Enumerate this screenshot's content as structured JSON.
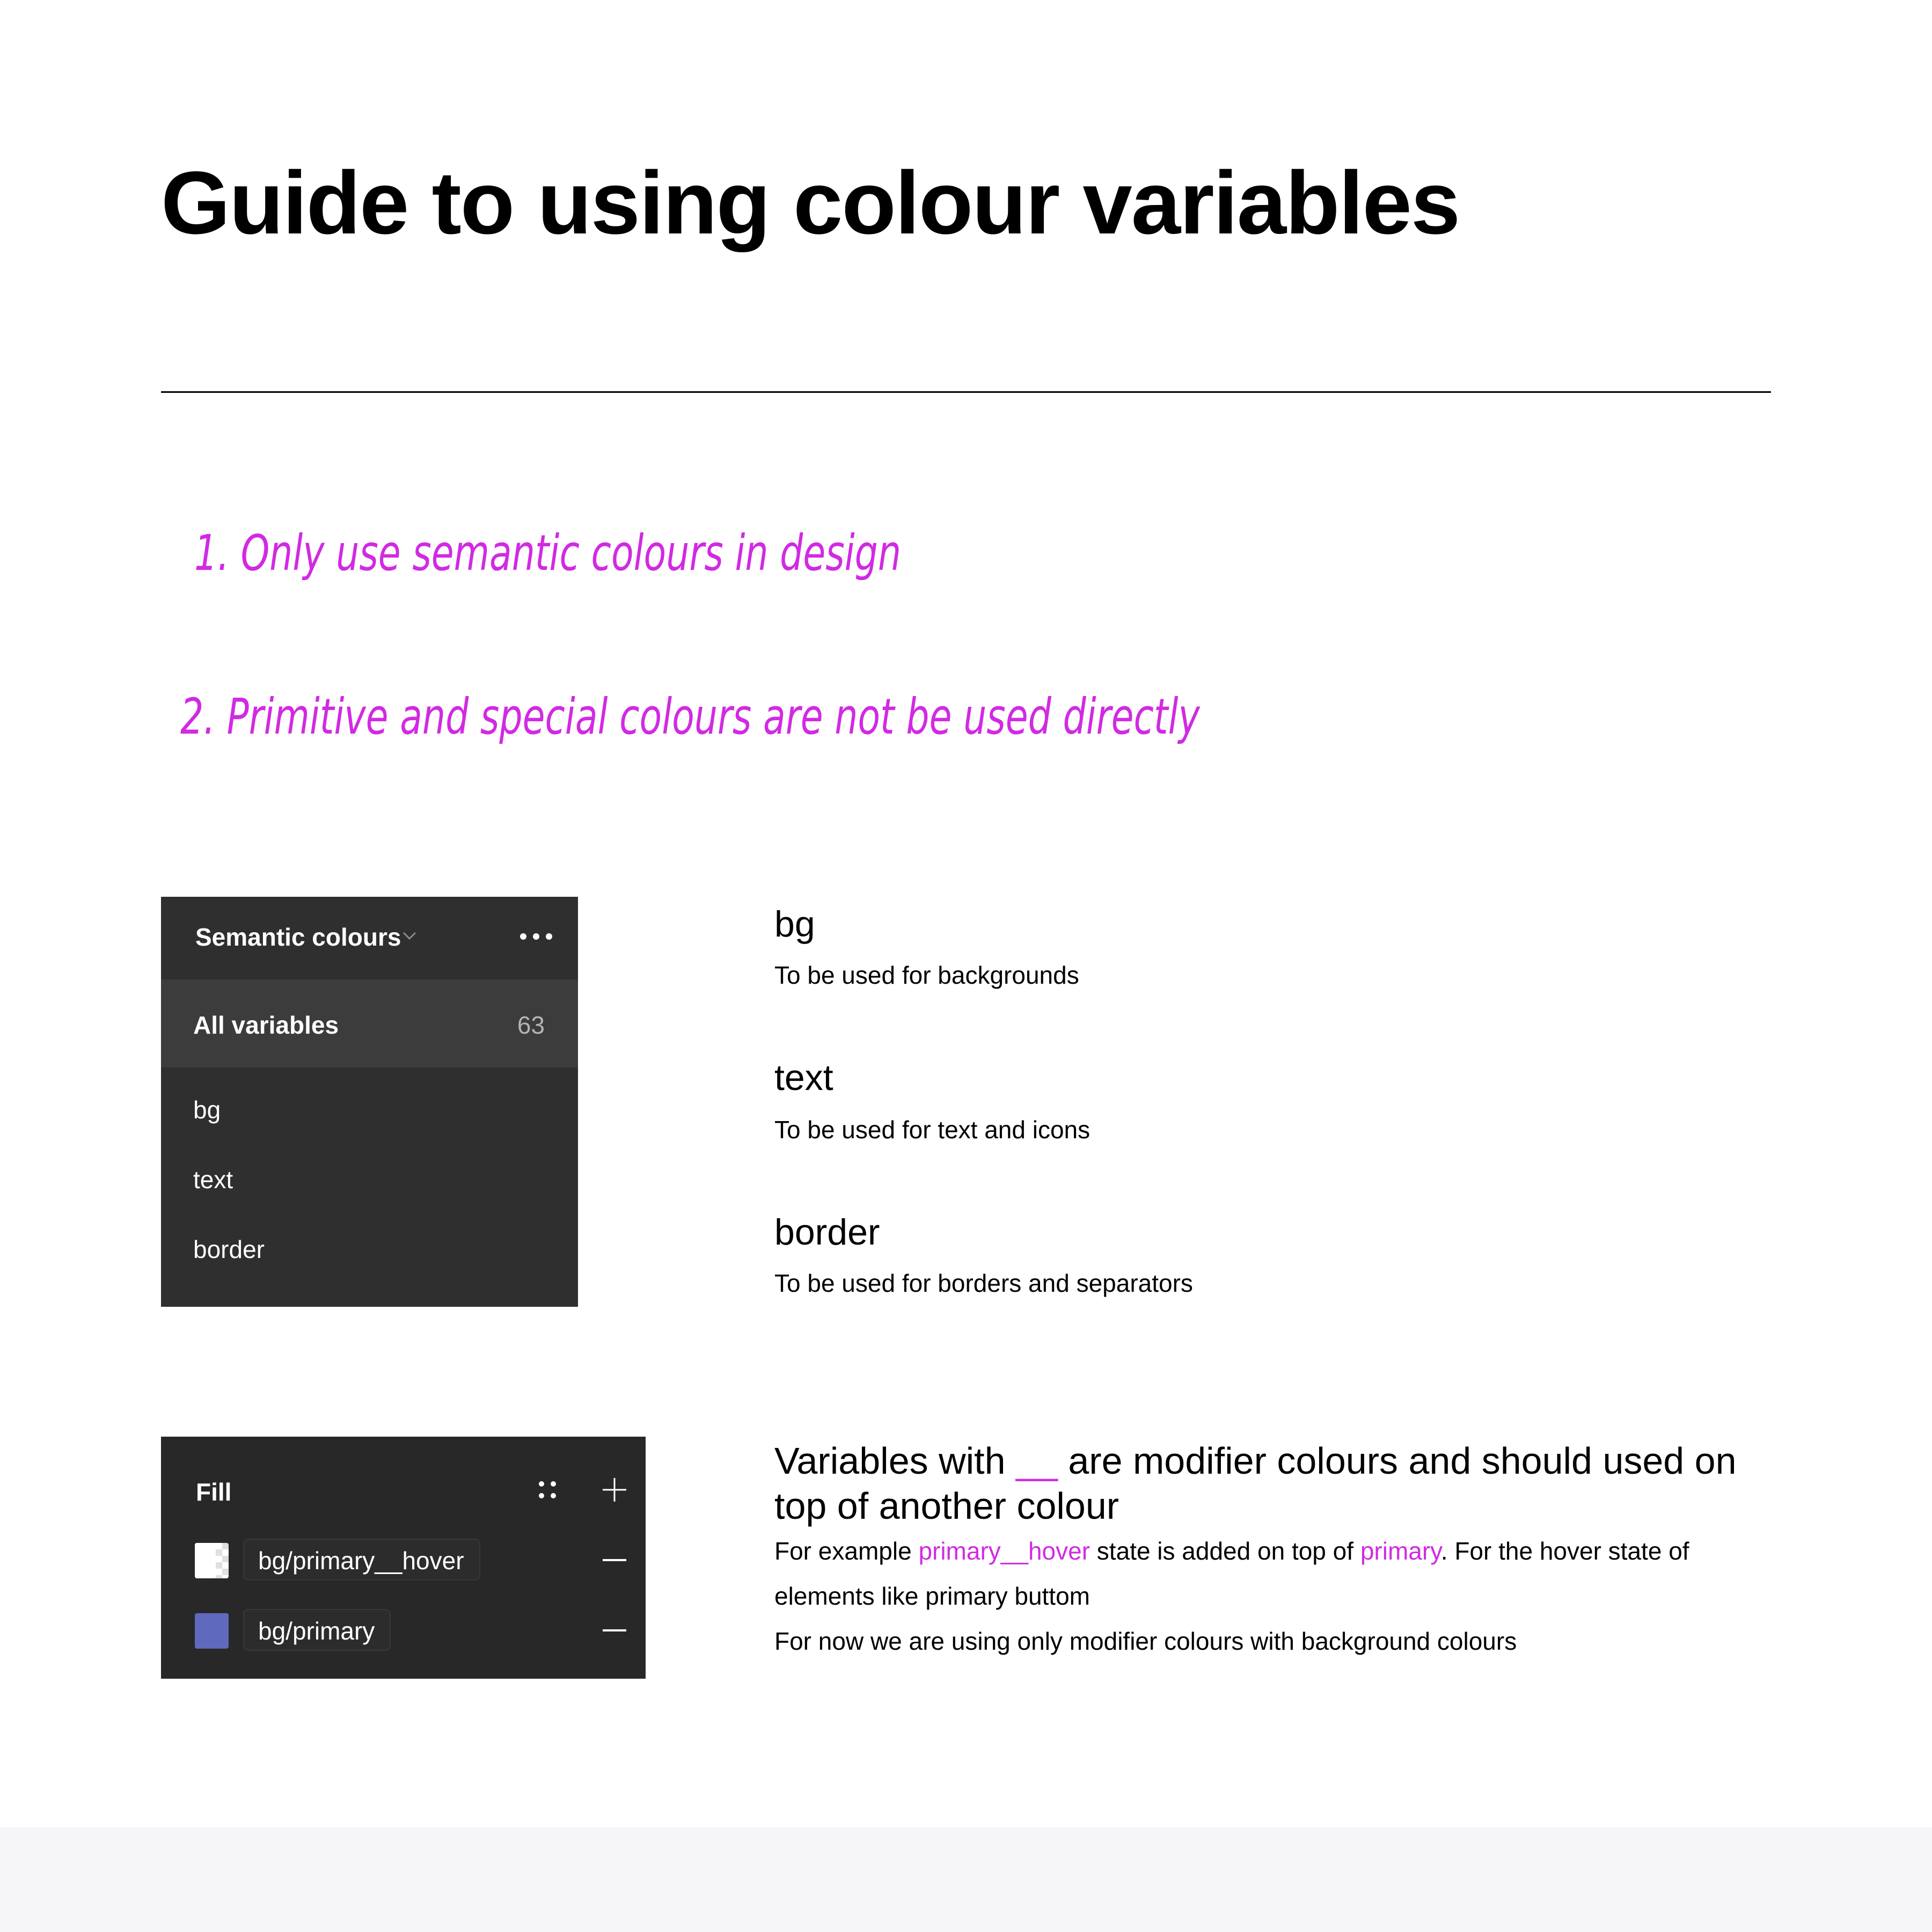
{
  "page": {
    "title": "Guide to using colour variables"
  },
  "rules": [
    "1. Only use semantic colours in design",
    "2. Primitive and special colours are not be used directly"
  ],
  "variables_panel": {
    "collection_name": "Semantic colours",
    "chevron_icon": "chevron-down",
    "more_icon": "ellipsis",
    "all_variables": {
      "label": "All variables",
      "count": "63"
    },
    "groups": [
      "bg",
      "text",
      "border"
    ]
  },
  "group_descriptions": [
    {
      "name": "bg",
      "description": "To be used for backgrounds"
    },
    {
      "name": "text",
      "description": "To be used for text and icons"
    },
    {
      "name": "border",
      "description": "To be used for borders and separators"
    }
  ],
  "fill_panel": {
    "title": "Fill",
    "styles_icon": "four-dots-grid",
    "add_icon": "plus",
    "remove_icon": "minus",
    "fills": [
      {
        "swatch": "transparent-checker",
        "variable": "bg/primary__hover"
      },
      {
        "swatch": "#5f6abf",
        "variable": "bg/primary"
      }
    ]
  },
  "modifier_note": {
    "heading_before": "Variables with ",
    "heading_token": "__",
    "heading_after": " are modifier colours and should used on top of another colour",
    "body_line1_a": "For example ",
    "body_line1_token1": "primary__hover",
    "body_line1_b": " state is added on top of ",
    "body_line1_token2": "primary",
    "body_line1_c": ". For the hover state of elements like primary buttom",
    "body_line2": "For now we are using only modifier colours with background colours"
  },
  "colors": {
    "accent_magenta": "#d12ae3",
    "panel_bg": "#2f2f2f",
    "panel_row_selected": "#3c3c3c",
    "fill_panel_bg": "#282828",
    "primary_swatch": "#5f6abf",
    "footer_band": "#f6f6f8"
  }
}
